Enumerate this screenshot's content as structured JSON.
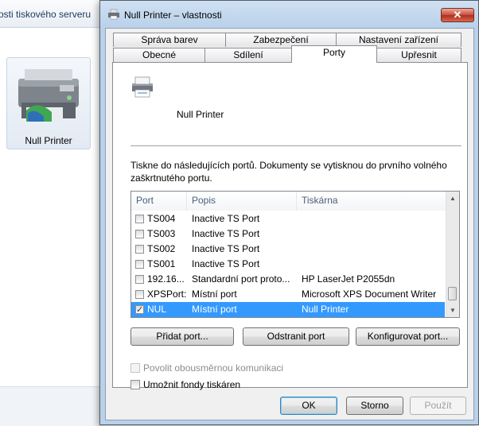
{
  "background_window": {
    "toolbar_text": "osti tiskového serveru",
    "device_label": "Null Printer"
  },
  "dialog": {
    "title": "Null Printer – vlastnosti",
    "close_glyph": "✕",
    "tabs_top": [
      "Správa barev",
      "Zabezpečení",
      "Nastavení zařízení"
    ],
    "tabs_bottom": [
      "Obecné",
      "Sdílení",
      "Porty",
      "Upřesnit"
    ],
    "active_tab": "Porty",
    "printer_name": "Null Printer",
    "description": "Tiskne do následujících portů. Dokumenty se vytisknou do prvního volného zaškrtnutého portu.",
    "port_list": {
      "columns": [
        "Port",
        "Popis",
        "Tiskárna"
      ],
      "rows": [
        {
          "checked": false,
          "selected": false,
          "port": "TS004",
          "desc": "Inactive TS Port",
          "printer": ""
        },
        {
          "checked": false,
          "selected": false,
          "port": "TS003",
          "desc": "Inactive TS Port",
          "printer": ""
        },
        {
          "checked": false,
          "selected": false,
          "port": "TS002",
          "desc": "Inactive TS Port",
          "printer": ""
        },
        {
          "checked": false,
          "selected": false,
          "port": "TS001",
          "desc": "Inactive TS Port",
          "printer": ""
        },
        {
          "checked": false,
          "selected": false,
          "port": "192.16...",
          "desc": "Standardní port proto...",
          "printer": "HP LaserJet P2055dn"
        },
        {
          "checked": false,
          "selected": false,
          "port": "XPSPort:",
          "desc": "Místní port",
          "printer": "Microsoft XPS Document Writer"
        },
        {
          "checked": true,
          "selected": true,
          "port": "NUL",
          "desc": "Místní port",
          "printer": "Null Printer"
        }
      ]
    },
    "buttons": {
      "add_port": "Přidat port...",
      "delete_port": "Odstranit port",
      "configure_port": "Konfigurovat port..."
    },
    "options": {
      "bidirectional": {
        "label": "Povolit obousměrnou komunikaci",
        "checked": false,
        "enabled": false
      },
      "pooling": {
        "label": "Umožnit fondy tiskáren",
        "checked": false,
        "enabled": true
      }
    },
    "footer": {
      "ok": "OK",
      "cancel": "Storno",
      "apply": "Použít"
    }
  }
}
